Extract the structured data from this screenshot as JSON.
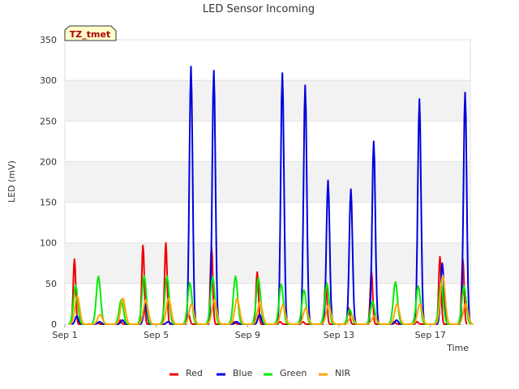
{
  "chart_data": {
    "type": "line",
    "title": "LED Sensor Incoming",
    "xlabel": "Time",
    "ylabel": "LED (mV)",
    "tag": "TZ_tmet",
    "ylim": [
      0,
      350
    ],
    "yticks": [
      0,
      50,
      100,
      150,
      200,
      250,
      300,
      350
    ],
    "xlim": [
      "2023-09-01",
      "2023-09-18.75"
    ],
    "xticks": [
      {
        "x": "2023-09-01",
        "label": "Sep 1"
      },
      {
        "x": "2023-09-05",
        "label": "Sep 5"
      },
      {
        "x": "2023-09-09",
        "label": "Sep 9"
      },
      {
        "x": "2023-09-13",
        "label": "Sep 13"
      },
      {
        "x": "2023-09-17",
        "label": "Sep 17"
      }
    ],
    "grid": true,
    "legend": "bottom",
    "series": [
      {
        "name": "Red",
        "color": "#ee0000",
        "peaks": [
          {
            "x": "2023-09-01T12:00",
            "y": 80
          },
          {
            "x": "2023-09-02T12:00",
            "y": 2
          },
          {
            "x": "2023-09-03T12:00",
            "y": 5
          },
          {
            "x": "2023-09-04T12:00",
            "y": 97
          },
          {
            "x": "2023-09-05T12:00",
            "y": 100
          },
          {
            "x": "2023-09-06T12:00",
            "y": 12
          },
          {
            "x": "2023-09-07T12:00",
            "y": 95
          },
          {
            "x": "2023-09-08T12:00",
            "y": 3
          },
          {
            "x": "2023-09-09T12:00",
            "y": 64
          },
          {
            "x": "2023-09-10T12:00",
            "y": 3
          },
          {
            "x": "2023-09-11T12:00",
            "y": 3
          },
          {
            "x": "2023-09-12T12:00",
            "y": 52
          },
          {
            "x": "2023-09-13T12:00",
            "y": 20
          },
          {
            "x": "2023-09-14T12:00",
            "y": 65
          },
          {
            "x": "2023-09-15T12:00",
            "y": 3
          },
          {
            "x": "2023-09-16T12:00",
            "y": 3
          },
          {
            "x": "2023-09-17T12:00",
            "y": 83
          },
          {
            "x": "2023-09-18T12:00",
            "y": 80
          }
        ]
      },
      {
        "name": "Blue",
        "color": "#0000dd",
        "peaks": [
          {
            "x": "2023-09-01T12:00",
            "y": 10
          },
          {
            "x": "2023-09-02T12:00",
            "y": 3
          },
          {
            "x": "2023-09-03T12:00",
            "y": 5
          },
          {
            "x": "2023-09-04T12:00",
            "y": 25
          },
          {
            "x": "2023-09-05T12:00",
            "y": 3
          },
          {
            "x": "2023-09-06T12:00",
            "y": 317
          },
          {
            "x": "2023-09-07T12:00",
            "y": 312
          },
          {
            "x": "2023-09-08T12:00",
            "y": 3
          },
          {
            "x": "2023-09-09T12:00",
            "y": 12
          },
          {
            "x": "2023-09-10T12:00",
            "y": 309
          },
          {
            "x": "2023-09-11T12:00",
            "y": 294
          },
          {
            "x": "2023-09-12T12:00",
            "y": 177
          },
          {
            "x": "2023-09-13T12:00",
            "y": 166
          },
          {
            "x": "2023-09-14T12:00",
            "y": 225
          },
          {
            "x": "2023-09-15T12:00",
            "y": 5
          },
          {
            "x": "2023-09-16T12:00",
            "y": 277
          },
          {
            "x": "2023-09-17T12:00",
            "y": 75
          },
          {
            "x": "2023-09-18T12:00",
            "y": 285
          }
        ]
      },
      {
        "name": "Green",
        "color": "#00ee00",
        "peaks": [
          {
            "x": "2023-09-01T12:00",
            "y": 48
          },
          {
            "x": "2023-09-02T12:00",
            "y": 59
          },
          {
            "x": "2023-09-03T12:00",
            "y": 30
          },
          {
            "x": "2023-09-04T12:00",
            "y": 60
          },
          {
            "x": "2023-09-05T12:00",
            "y": 59
          },
          {
            "x": "2023-09-06T12:00",
            "y": 51
          },
          {
            "x": "2023-09-07T12:00",
            "y": 58
          },
          {
            "x": "2023-09-08T12:00",
            "y": 59
          },
          {
            "x": "2023-09-09T12:00",
            "y": 57
          },
          {
            "x": "2023-09-10T12:00",
            "y": 49
          },
          {
            "x": "2023-09-11T12:00",
            "y": 42
          },
          {
            "x": "2023-09-12T12:00",
            "y": 50
          },
          {
            "x": "2023-09-13T12:00",
            "y": 18
          },
          {
            "x": "2023-09-14T12:00",
            "y": 28
          },
          {
            "x": "2023-09-15T12:00",
            "y": 52
          },
          {
            "x": "2023-09-16T12:00",
            "y": 47
          },
          {
            "x": "2023-09-17T12:00",
            "y": 50
          },
          {
            "x": "2023-09-18T12:00",
            "y": 47
          }
        ]
      },
      {
        "name": "NIR",
        "color": "#ffa500",
        "peaks": [
          {
            "x": "2023-09-01T12:00",
            "y": 35
          },
          {
            "x": "2023-09-02T12:00",
            "y": 12
          },
          {
            "x": "2023-09-03T12:00",
            "y": 32
          },
          {
            "x": "2023-09-04T12:00",
            "y": 30
          },
          {
            "x": "2023-09-05T12:00",
            "y": 32
          },
          {
            "x": "2023-09-06T12:00",
            "y": 25
          },
          {
            "x": "2023-09-07T12:00",
            "y": 30
          },
          {
            "x": "2023-09-08T12:00",
            "y": 32
          },
          {
            "x": "2023-09-09T12:00",
            "y": 28
          },
          {
            "x": "2023-09-10T12:00",
            "y": 24
          },
          {
            "x": "2023-09-11T12:00",
            "y": 20
          },
          {
            "x": "2023-09-12T12:00",
            "y": 24
          },
          {
            "x": "2023-09-13T12:00",
            "y": 10
          },
          {
            "x": "2023-09-14T12:00",
            "y": 10
          },
          {
            "x": "2023-09-15T12:00",
            "y": 25
          },
          {
            "x": "2023-09-16T12:00",
            "y": 25
          },
          {
            "x": "2023-09-17T12:00",
            "y": 60
          },
          {
            "x": "2023-09-18T12:00",
            "y": 25
          }
        ]
      }
    ]
  }
}
